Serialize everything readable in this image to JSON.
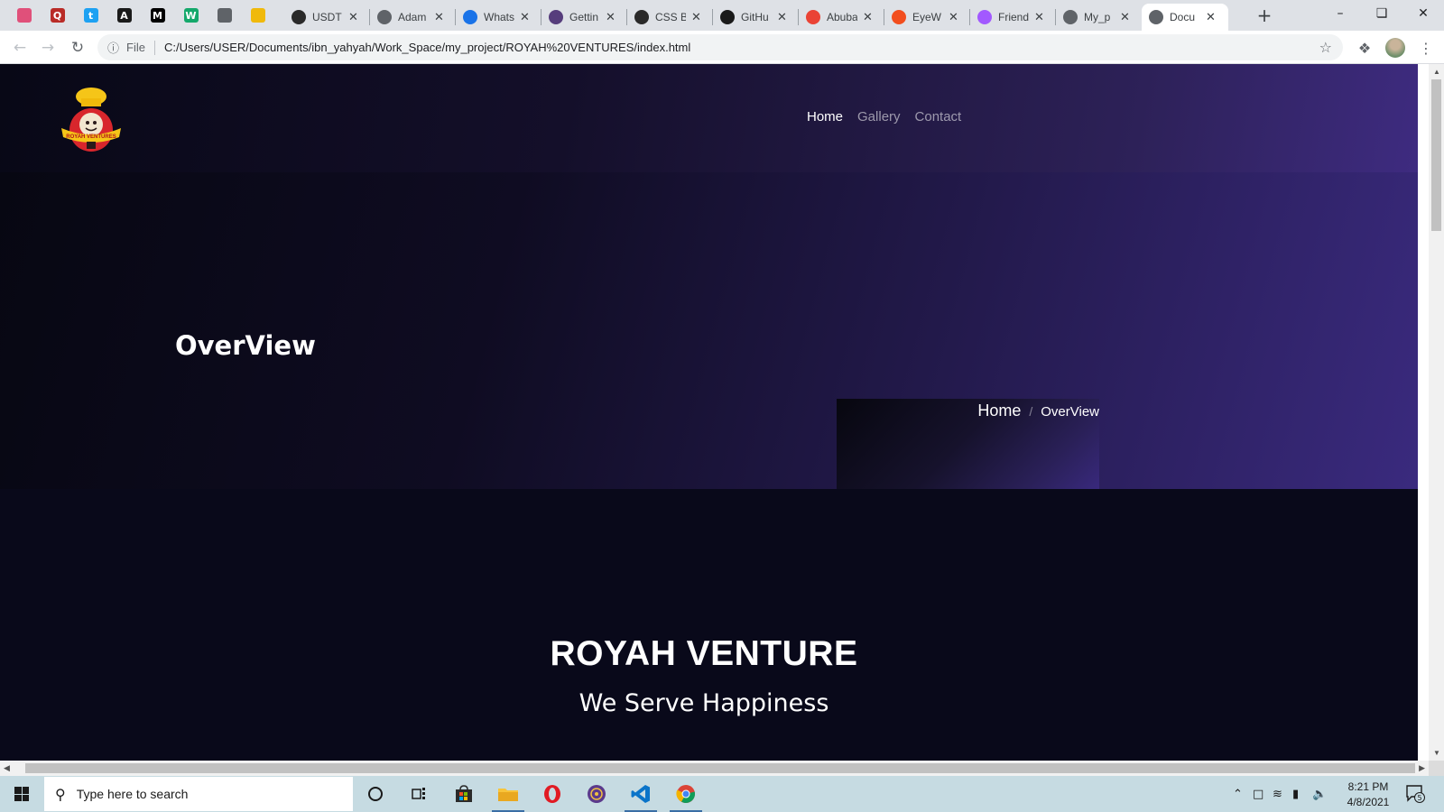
{
  "browser": {
    "pinned_tabs": [
      {
        "icon": "colorful-favicon-icon",
        "color": "#e0507a"
      },
      {
        "icon": "quora-icon",
        "color": "#b92b27",
        "glyph": "Q"
      },
      {
        "icon": "twitter-icon",
        "color": "#1da1f2",
        "glyph": "t"
      },
      {
        "icon": "app-store-icon",
        "color": "#1a1a1a",
        "glyph": "A"
      },
      {
        "icon": "medium-icon",
        "color": "#000000",
        "glyph": "M"
      },
      {
        "icon": "wattpad-icon",
        "color": "#14a86b",
        "glyph": "W"
      },
      {
        "icon": "globe-icon",
        "color": "#5f6368",
        "glyph": ""
      },
      {
        "icon": "binance-icon",
        "color": "#f0b90b",
        "glyph": ""
      }
    ],
    "tabs": [
      {
        "title": "USDT",
        "icon": "usdt-icon",
        "color": "#2a2a2a"
      },
      {
        "title": "Adam",
        "icon": "globe-icon",
        "color": "#5f6368"
      },
      {
        "title": "Whats",
        "icon": "chat-icon",
        "color": "#1a73e8"
      },
      {
        "title": "Gettin",
        "icon": "bootstrap-icon",
        "color": "#563d7c"
      },
      {
        "title": "CSS B",
        "icon": "css-icon",
        "color": "#2a2a2a"
      },
      {
        "title": "GitHu",
        "icon": "github-icon",
        "color": "#1a1a1a"
      },
      {
        "title": "Abuba",
        "icon": "gmail-icon",
        "color": "#ea4335"
      },
      {
        "title": "EyeW",
        "icon": "figma-icon",
        "color": "#f24e1e"
      },
      {
        "title": "Friend",
        "icon": "figma-file-icon",
        "color": "#a259ff"
      },
      {
        "title": "My_p",
        "icon": "globe-icon",
        "color": "#5f6368"
      },
      {
        "title": "Docu",
        "icon": "globe-icon",
        "color": "#5f6368",
        "active": true
      }
    ],
    "address_prefix": "File",
    "url": "C:/Users/USER/Documents/ibn_yahyah/Work_Space/my_project/ROYAH%20VENTURES/index.html"
  },
  "site": {
    "logo_text": "ROYAH VENTURES",
    "nav": [
      "Home",
      "Gallery",
      "Contact"
    ],
    "hero_title": "OverView",
    "breadcrumb": {
      "home": "Home",
      "separator": "/",
      "current": "OverView"
    },
    "brand": "ROYAH VENTURE",
    "tagline": "We Serve Happiness"
  },
  "taskbar": {
    "search_placeholder": "Type here to search",
    "time": "8:21 PM",
    "date": "4/8/2021",
    "notification_count": "5"
  }
}
